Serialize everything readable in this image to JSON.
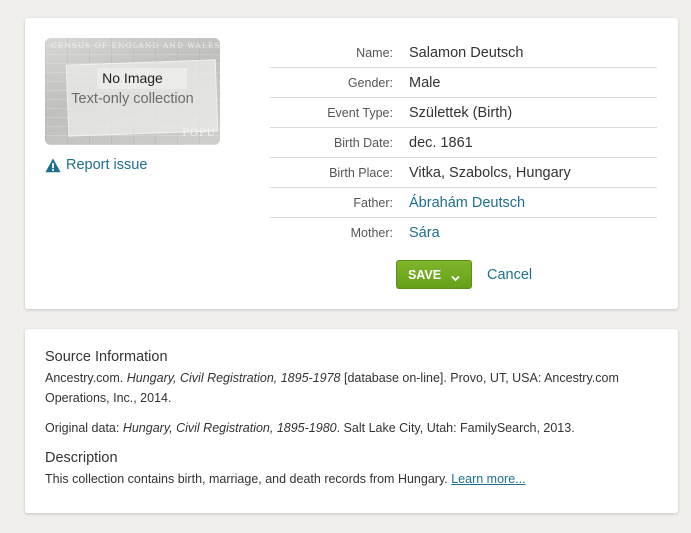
{
  "thumbnail": {
    "no_image": "No Image",
    "text_only": "Text-only collection",
    "census_caption": "CENSUS OF ENGLAND AND WALES.",
    "popu_caption": "POPU"
  },
  "report_issue": "Report issue",
  "fields": [
    {
      "label": "Name:",
      "value": "Salamon Deutsch",
      "link": false
    },
    {
      "label": "Gender:",
      "value": "Male",
      "link": false
    },
    {
      "label": "Event Type:",
      "value": "Születtek (Birth)",
      "link": false
    },
    {
      "label": "Birth Date:",
      "value": "dec. 1861",
      "link": false
    },
    {
      "label": "Birth Place:",
      "value": "Vitka, Szabolcs, Hungary",
      "link": false
    },
    {
      "label": "Father:",
      "value": "Ábrahám Deutsch",
      "link": true
    },
    {
      "label": "Mother:",
      "value": "Sára",
      "link": true
    }
  ],
  "actions": {
    "save": "SAVE",
    "cancel": "Cancel"
  },
  "source": {
    "heading": "Source Information",
    "citation_prefix": "Ancestry.com. ",
    "citation_title": "Hungary, Civil Registration, 1895-1978",
    "citation_suffix": " [database on-line]. Provo, UT, USA: Ancestry.com Operations, Inc., 2014.",
    "original_prefix": "Original data: ",
    "original_title": "Hungary, Civil Registration, 1895-1980",
    "original_suffix": ". Salt Lake City, Utah: FamilySearch, 2013.",
    "description_heading": "Description",
    "description_text": "This collection contains birth, marriage, and death records from Hungary. ",
    "learn_more": "Learn more..."
  },
  "colors": {
    "link": "#1d6f8d",
    "save_button": "#6fa822",
    "background": "#f0efec"
  }
}
